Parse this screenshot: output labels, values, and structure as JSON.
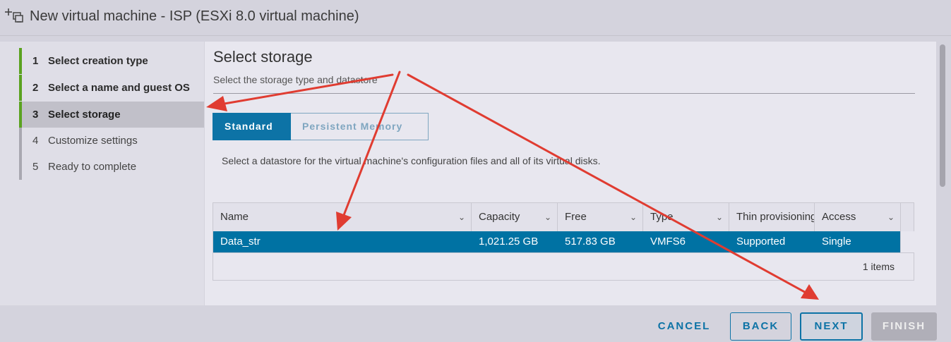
{
  "window": {
    "title": "New virtual machine - ISP (ESXi 8.0 virtual machine)",
    "icon": "new-vm-icon"
  },
  "wizard_steps": [
    {
      "number": "1",
      "label": "Select creation type",
      "state": "done"
    },
    {
      "number": "2",
      "label": "Select a name and guest OS",
      "state": "done"
    },
    {
      "number": "3",
      "label": "Select storage",
      "state": "active"
    },
    {
      "number": "4",
      "label": "Customize settings",
      "state": "todo"
    },
    {
      "number": "5",
      "label": "Ready to complete",
      "state": "todo"
    }
  ],
  "main": {
    "title": "Select storage",
    "subtitle": "Select the storage type and datastore",
    "tabs": [
      {
        "label": "Standard",
        "selected": true
      },
      {
        "label": "Persistent Memory",
        "selected": false
      }
    ],
    "description": "Select a datastore for the virtual machine's configuration files and all of its virtual disks."
  },
  "datastore_table": {
    "columns": [
      "Name",
      "Capacity",
      "Free",
      "Type",
      "Thin provisioning",
      "Access"
    ],
    "rows": [
      {
        "name": "Data_str",
        "capacity": "1,021.25 GB",
        "free": "517.83 GB",
        "type": "VMFS6",
        "thin": "Supported",
        "access": "Single",
        "selected": true
      }
    ],
    "footer": "1 items"
  },
  "buttons": {
    "cancel": "CANCEL",
    "back": "BACK",
    "next": "NEXT",
    "finish": "FINISH",
    "finish_disabled": true
  },
  "colors": {
    "accent": "#0d73a6",
    "step_done": "#5aa220",
    "selected_row": "#0072a3",
    "annotation_arrow": "#e03c31"
  },
  "annotations": [
    {
      "type": "arrow",
      "target": "step-3-select-storage"
    },
    {
      "type": "arrow",
      "target": "datastore-row-data-str"
    },
    {
      "type": "arrow",
      "target": "next-button"
    }
  ]
}
